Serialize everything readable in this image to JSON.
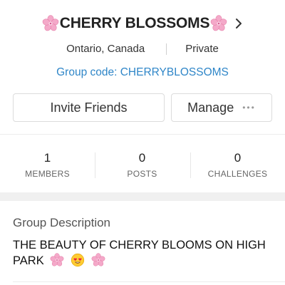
{
  "header": {
    "title": "CHERRY BLOSSOMS",
    "title_icons": [
      "cherry-blossom-icon",
      "cherry-blossom-icon"
    ],
    "location": "Ontario, Canada",
    "privacy": "Private",
    "group_code": "Group code: CHERRYBLOSSOMS"
  },
  "actions": {
    "invite_label": "Invite Friends",
    "manage_label": "Manage",
    "manage_dots": "•••"
  },
  "stats": [
    {
      "value": "1",
      "label": "MEMBERS"
    },
    {
      "value": "0",
      "label": "POSTS"
    },
    {
      "value": "0",
      "label": "CHALLENGES"
    }
  ],
  "description": {
    "heading": "Group Description",
    "text": "THE BEAUTY OF CHERRY BLOOMS ON HIGH PARK",
    "trailing_icons": [
      "cherry-blossom-icon",
      "heart-eyes-emoji-icon",
      "cherry-blossom-icon"
    ]
  },
  "colors": {
    "link": "#2f86c8",
    "blossom": "#f3a6c8",
    "band": "#f0f0f0"
  }
}
